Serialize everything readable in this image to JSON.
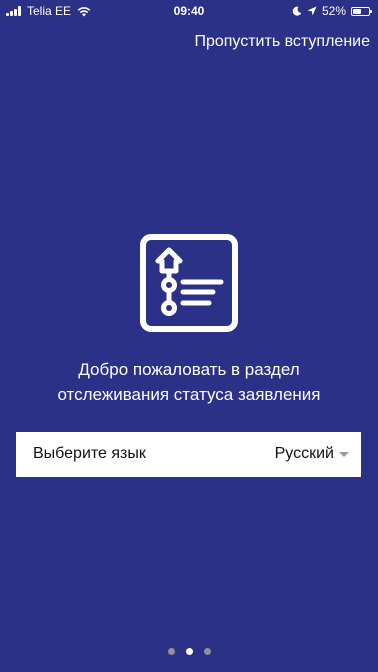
{
  "status_bar": {
    "carrier": "Telia EE",
    "time": "09:40",
    "battery": "52%",
    "battery_level": 0.52,
    "icons": [
      "signal-icon",
      "wifi-icon",
      "moon-icon",
      "location-arrow-icon",
      "battery-icon"
    ]
  },
  "skip_label": "Пропустить вступление",
  "welcome": {
    "line1": "Добро пожаловать в раздел",
    "line2": "отслеживания статуса заявления"
  },
  "language": {
    "label": "Выберите язык",
    "selected": "Русский"
  },
  "pagination": {
    "total": 3,
    "active_index": 1
  },
  "colors": {
    "background": "#2a3187",
    "panel": "#ffffff",
    "inactive_dot": "#8f8f9a",
    "caret": "#9a9a9a"
  }
}
